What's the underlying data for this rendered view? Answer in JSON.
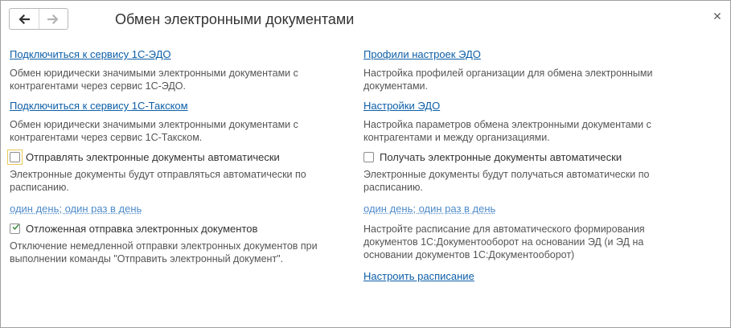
{
  "window": {
    "title": "Обмен электронными документами"
  },
  "icons": {
    "back": "arrow-left-icon",
    "forward": "arrow-right-icon",
    "close": "close-icon"
  },
  "left": {
    "edo_link": "Подключиться к сервису 1С-ЭДО",
    "edo_desc": "Обмен юридически значимыми электронными документами с контрагентами через сервис 1С-ЭДО.",
    "taxcom_link": "Подключиться к сервису 1С-Такском",
    "taxcom_desc": "Обмен юридически значимыми электронными документами с контрагентами через сервис 1С-Такском.",
    "send_auto_label": "Отправлять электронные документы автоматически",
    "send_auto_checked": false,
    "send_auto_desc": "Электронные документы будут отправляться автоматически по расписанию.",
    "send_schedule_link": "один день; один раз в день",
    "deferred_label": "Отложенная отправка электронных документов",
    "deferred_checked": true,
    "deferred_desc": "Отключение немедленной отправки электронных документов при выполнении команды \"Отправить электронный документ\"."
  },
  "right": {
    "profiles_link": "Профили настроек ЭДО",
    "profiles_desc": "Настройка профилей организации для обмена электронными документами.",
    "settings_link": "Настройки ЭДО",
    "settings_desc": "Настройка параметров обмена электронными документами с контрагентами и между организациями.",
    "receive_auto_label": "Получать электронные документы автоматически",
    "receive_auto_checked": false,
    "receive_auto_desc": "Электронные документы будут получаться автоматически по расписанию.",
    "receive_schedule_link": "один день; один раз в день",
    "docflow_desc": "Настройте расписание для автоматического формирования документов 1С:Документооборот на основании ЭД (и ЭД на основании документов 1С:Документооборот)",
    "configure_schedule_link": "Настроить расписание"
  }
}
